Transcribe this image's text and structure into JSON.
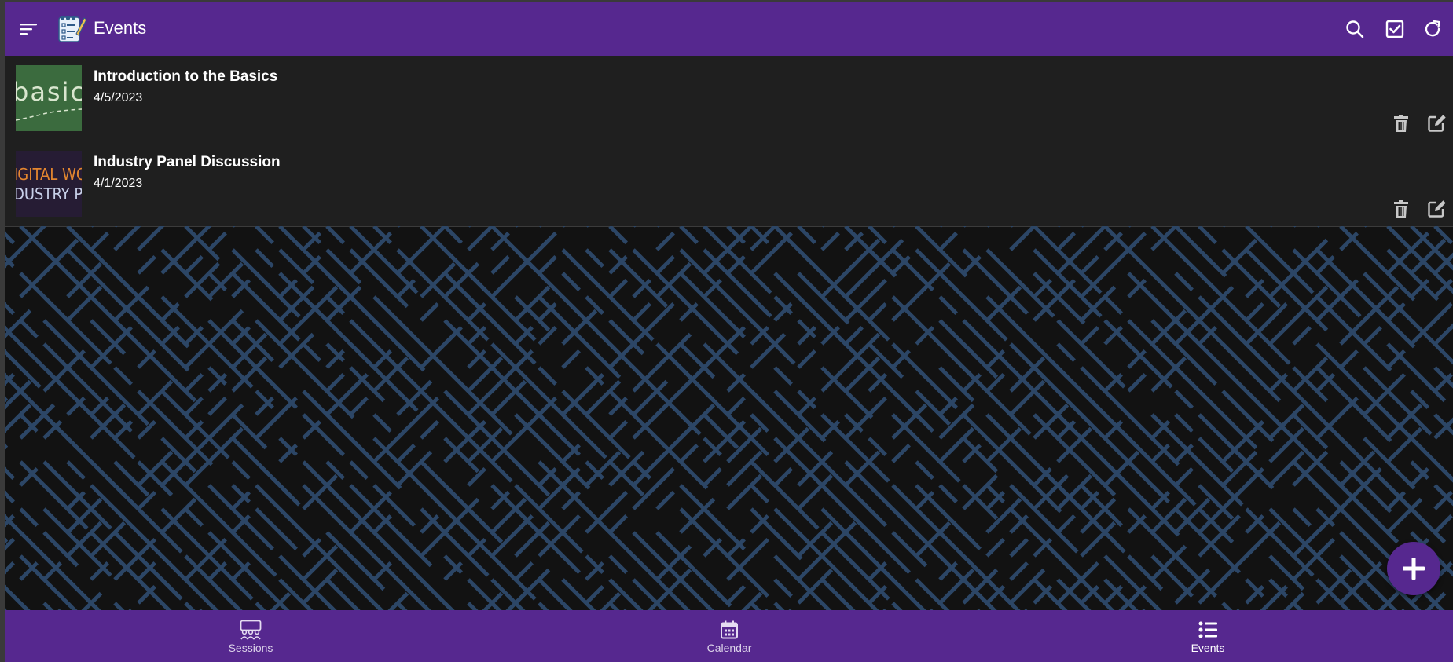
{
  "header": {
    "title": "Events",
    "icons": [
      "menu-icon",
      "notepad-icon",
      "search-icon",
      "checkbox-icon",
      "refresh-icon"
    ]
  },
  "events": [
    {
      "title": "Introduction to the Basics",
      "date": "4/5/2023",
      "thumb_text": "basic",
      "thumb_bg": "#3b6b3e"
    },
    {
      "title": "Industry Panel Discussion",
      "date": "4/1/2023",
      "thumb_text_1": "IGITAL WORL",
      "thumb_text_2": "DUSTRY PAN",
      "thumb_bg": "#1c1b2e"
    }
  ],
  "bottom_nav": {
    "items": [
      {
        "label": "Sessions",
        "icon": "sessions-icon"
      },
      {
        "label": "Calendar",
        "icon": "calendar-icon"
      },
      {
        "label": "Events",
        "icon": "list-icon",
        "active": true
      }
    ]
  },
  "colors": {
    "primary": "#56288f",
    "surface": "#1f1f1f",
    "background": "#121212",
    "maze_line": "#2c4666"
  }
}
